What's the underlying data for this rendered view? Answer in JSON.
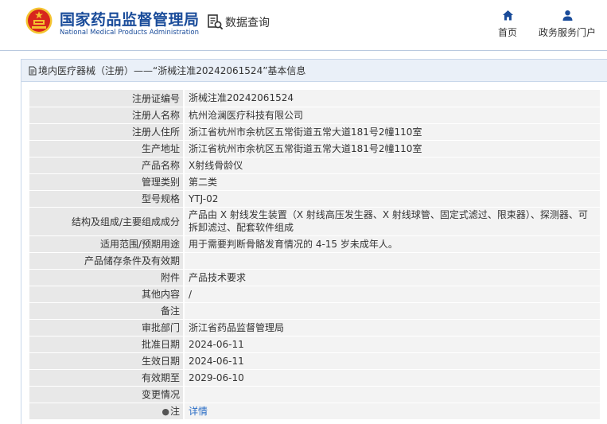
{
  "header": {
    "brand_cn": "国家药品监督管理局",
    "brand_en": "National Medical Products Administration",
    "data_query": "数据查询",
    "nav": [
      {
        "label": "首页",
        "icon": "home-icon"
      },
      {
        "label": "政务服务门户",
        "icon": "user-icon"
      }
    ]
  },
  "panel": {
    "title": "境内医疗器械（注册）——“浙械注准20242061524”基本信息",
    "rows": [
      {
        "label": "注册证编号",
        "value": "浙械注准20242061524"
      },
      {
        "label": "注册人名称",
        "value": "杭州沧澜医疗科技有限公司"
      },
      {
        "label": "注册人住所",
        "value": "浙江省杭州市余杭区五常街道五常大道181号2幢110室"
      },
      {
        "label": "生产地址",
        "value": "浙江省杭州市余杭区五常街道五常大道181号2幢110室"
      },
      {
        "label": "产品名称",
        "value": "X射线骨龄仪"
      },
      {
        "label": "管理类别",
        "value": "第二类"
      },
      {
        "label": "型号规格",
        "value": "YTJ-02"
      },
      {
        "label": "结构及组成/主要组成成分",
        "value": "产品由 X 射线发生装置（X 射线高压发生器、X 射线球管、固定式滤过、限束器）、探测器、可拆卸滤过、配套软件组成"
      },
      {
        "label": "适用范围/预期用途",
        "value": "用于需要判断骨骼发育情况的 4-15 岁未成年人。"
      },
      {
        "label": "产品储存条件及有效期",
        "value": ""
      },
      {
        "label": "附件",
        "value": "产品技术要求"
      },
      {
        "label": "其他内容",
        "value": "/"
      },
      {
        "label": "备注",
        "value": ""
      },
      {
        "label": "审批部门",
        "value": "浙江省药品监督管理局"
      },
      {
        "label": "批准日期",
        "value": "2024-06-11"
      },
      {
        "label": "生效日期",
        "value": "2024-06-11"
      },
      {
        "label": "有效期至",
        "value": "2029-06-10"
      },
      {
        "label": "变更情况",
        "value": ""
      }
    ],
    "note": {
      "label": "注",
      "link": "详情"
    }
  },
  "colors": {
    "brand_blue": "#1a4c9a",
    "label_bg": "#e8e8e8",
    "value_bg": "#f3f3f3",
    "link": "#2a6dc5",
    "emblem_red": "#d7261d",
    "emblem_gold": "#f4c430"
  }
}
